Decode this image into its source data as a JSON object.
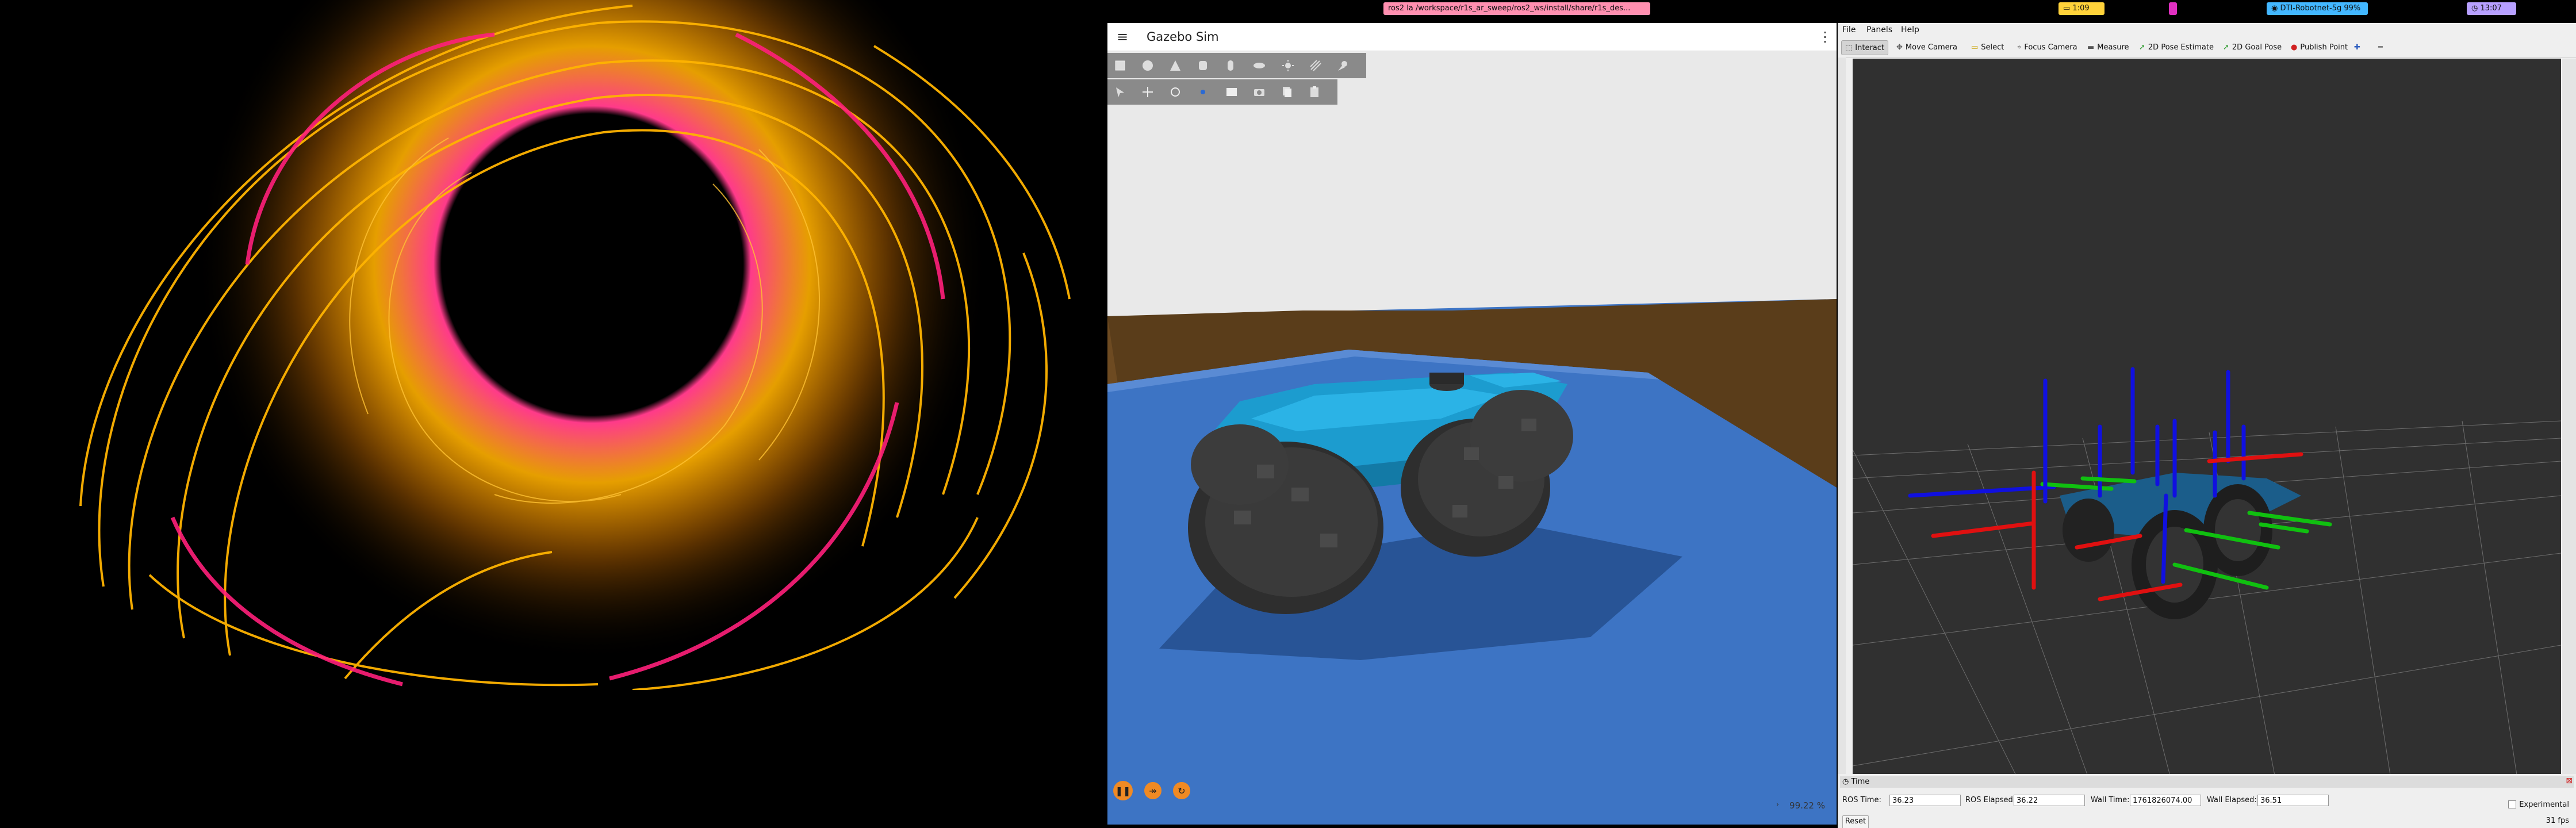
{
  "topbar": {
    "terminal_tab": "ros2 la  /workspace/r1s_ar_sweep/ros2_ws/install/share/r1s_des...",
    "clock_status": "1:09",
    "network": "DTI-Robotnet-5g 99%",
    "time": "13:07"
  },
  "gazebo": {
    "title": "Gazebo Sim",
    "menu_icon": "hamburger-icon",
    "options_icon": "kebab-icon",
    "toolbar1": [
      "box-shape-icon",
      "sphere-shape-icon",
      "cone-shape-icon",
      "cylinder-shape-icon",
      "capsule-shape-icon",
      "ellipsoid-shape-icon",
      "sun-light-icon",
      "directional-light-icon",
      "spot-light-icon"
    ],
    "toolbar2": [
      "select-icon",
      "translate-icon",
      "rotate-icon",
      "snap-icon",
      "grid-icon",
      "camera-icon",
      "copy-icon",
      "paste-icon"
    ],
    "rtf": "99.22 %",
    "colors": {
      "toolbar": "#8a8a8a",
      "control": "#f08a24",
      "robot": "#1c9ccf",
      "floor": "#3d74c4",
      "wall": "#5a3d1a"
    }
  },
  "rviz": {
    "menu": [
      "File",
      "Panels",
      "Help"
    ],
    "tools": [
      {
        "icon": "interact-icon",
        "label": "Interact"
      },
      {
        "icon": "move-camera-icon",
        "label": "Move Camera"
      },
      {
        "icon": "select-icon",
        "label": "Select"
      },
      {
        "icon": "focus-camera-icon",
        "label": "Focus Camera"
      },
      {
        "icon": "measure-icon",
        "label": "Measure"
      },
      {
        "icon": "pose-estimate-icon",
        "label": "2D Pose Estimate"
      },
      {
        "icon": "goal-pose-icon",
        "label": "2D Goal Pose"
      },
      {
        "icon": "publish-point-icon",
        "label": "Publish Point"
      }
    ],
    "time_panel": {
      "header": "Time",
      "ros_time_label": "ROS Time:",
      "ros_time": "36.23",
      "ros_elapsed_label": "ROS Elapsed:",
      "ros_elapsed": "36.22",
      "wall_time_label": "Wall Time:",
      "wall_time": "1761826074.00",
      "wall_elapsed_label": "Wall Elapsed:",
      "wall_elapsed": "36.51",
      "experimental_label": "Experimental",
      "reset_label": "Reset",
      "fps": "31 fps"
    },
    "colors": {
      "background": "#303030",
      "grid": "#a0a0a0",
      "x_axis": "#e01010",
      "y_axis": "#10c010",
      "z_axis": "#1010e0"
    }
  },
  "wallpaper": {
    "colors": {
      "background": "#000000",
      "ring_orange": "#ffb400",
      "ring_pink": "#ff1f7a"
    }
  }
}
